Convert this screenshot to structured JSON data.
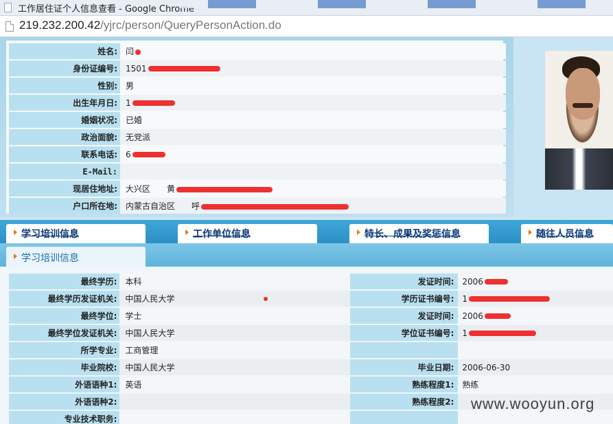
{
  "window": {
    "title": "工作居住证个人信息查看 - Google Chrome"
  },
  "address": {
    "host": "219.232.200.42",
    "path": "/yjrc/person/QueryPersonAction.do"
  },
  "person": {
    "rows": [
      {
        "label": "姓名:",
        "value": "闫",
        "redact_width": 8
      },
      {
        "label": "身份证编号:",
        "value": "1501",
        "redact_width": 105
      },
      {
        "label": "性别:",
        "value": "男",
        "redact_width": 0
      },
      {
        "label": "出生年月日:",
        "value": "1",
        "redact_width": 62
      },
      {
        "label": "婚姻状况:",
        "value": "已婚",
        "redact_width": 0
      },
      {
        "label": "政治面貌:",
        "value": "无党派",
        "redact_width": 0
      },
      {
        "label": "联系电话:",
        "value": "6",
        "redact_width": 48
      },
      {
        "label": "E-Mail:",
        "value": "",
        "redact_width": 0
      },
      {
        "label": "现居住地址:",
        "value": "大兴区　　黄",
        "redact_width": 140
      },
      {
        "label": "户口所在地:",
        "value": "内蒙古自治区　　呼",
        "redact_width": 215
      }
    ],
    "photo": "person-photo"
  },
  "tabs": [
    {
      "label": "学习培训信息"
    },
    {
      "label": "工作单位信息"
    },
    {
      "label": "特长、成果及奖惩信息"
    },
    {
      "label": "随往人员信息"
    }
  ],
  "section": {
    "title": "学习培训信息"
  },
  "education": {
    "rows": [
      {
        "label": "最终学历:",
        "value": "本科",
        "label2": "发证时间:",
        "value2": "2006",
        "redact2": 34
      },
      {
        "label": "最终学历发证机关:",
        "value": "中国人民大学",
        "label2": "学历证书编号:",
        "value2": "1",
        "redact2": 118
      },
      {
        "label": "最终学位:",
        "value": "学士",
        "label2": "发证时间:",
        "value2": "2006",
        "redact2": 38
      },
      {
        "label": "最终学位发证机关:",
        "value": "中国人民大学",
        "label2": "学位证书编号:",
        "value2": "1",
        "redact2": 98
      },
      {
        "label": "所学专业:",
        "value": "工商管理",
        "label2": "",
        "value2": "",
        "redact2": 0
      },
      {
        "label": "毕业院校:",
        "value": "中国人民大学",
        "label2": "毕业日期:",
        "value2": "2006-06-30",
        "redact2": 0
      },
      {
        "label": "外语语种1:",
        "value": "英语",
        "label2": "熟练程度1:",
        "value2": "熟练",
        "redact2": 0
      },
      {
        "label": "外语语种2:",
        "value": "",
        "label2": "熟练程度2:",
        "value2": "",
        "redact2": 0
      },
      {
        "label": "专业技术职务:",
        "value": "",
        "label2": "",
        "value2": "",
        "redact2": 0
      }
    ]
  },
  "watermark": "www.wooyun.org",
  "colors": {
    "label_bg": "#b9e0f0",
    "tab_bar": "#2d8fc6",
    "redaction": "#ee3030",
    "link": "#0d3b7a"
  }
}
